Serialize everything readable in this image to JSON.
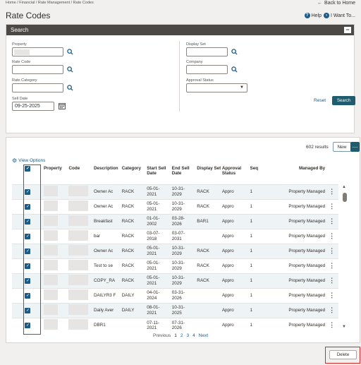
{
  "breadcrumb": "Home / Financial / Rate Management / Rate Codes",
  "back_link": "Back to Home",
  "title": "Rate Codes",
  "help": "Help",
  "want_to": "I Want To...",
  "search_panel": {
    "title": "Search",
    "property_label": "Property",
    "rate_code_label": "Rate Code",
    "rate_category_label": "Rate Category",
    "sell_date_label": "Sell Date",
    "sell_date_value": "09-25-2025",
    "display_set_label": "Display Set",
    "company_label": "Company",
    "approval_status_label": "Approval Status",
    "reset": "Reset",
    "search": "Search"
  },
  "results": {
    "count": "602 results",
    "new": "New",
    "view_options": "View Options",
    "headers": [
      "Property",
      "Code",
      "Description",
      "Category",
      "Start Sell Date",
      "End Sell Date",
      "Display Set",
      "Approval Status",
      "Seq",
      "Managed By"
    ],
    "rows": [
      {
        "description": "Owner Ac",
        "category": "RACK",
        "start": "05-01-2021",
        "end": "10-31-2029",
        "display_set": "RACK",
        "approval": "Appro",
        "seq": "1",
        "managed": "Property Managed"
      },
      {
        "description": "Owner Ac",
        "category": "RACK",
        "start": "05-01-2021",
        "end": "10-31-2029",
        "display_set": "RACK",
        "approval": "Appro",
        "seq": "1",
        "managed": "Property Managed"
      },
      {
        "description": "Breakfast",
        "category": "RACK",
        "start": "01-01-2002",
        "end": "03-28-2026",
        "display_set": "BAR1",
        "approval": "Appro",
        "seq": "1",
        "managed": "Property Managed"
      },
      {
        "description": "bar",
        "category": "RACK",
        "start": "03-07-2018",
        "end": "03-07-2031",
        "display_set": "",
        "approval": "Appro",
        "seq": "1",
        "managed": "Property Managed"
      },
      {
        "description": "Owner Ac",
        "category": "RACK",
        "start": "05-01-2021",
        "end": "10-31-2029",
        "display_set": "RACK",
        "approval": "Appro",
        "seq": "1",
        "managed": "Property Managed"
      },
      {
        "description": "Test to se",
        "category": "RACK",
        "start": "05-01-2021",
        "end": "10-31-2029",
        "display_set": "RACK",
        "approval": "Appro",
        "seq": "1",
        "managed": "Property Managed"
      },
      {
        "description": "COPY_RA",
        "category": "RACK",
        "start": "05-01-2021",
        "end": "10-31-2029",
        "display_set": "RACK",
        "approval": "Appro",
        "seq": "1",
        "managed": "Property Managed"
      },
      {
        "description": "DAILYR3 F",
        "category": "DAILY",
        "start": "04-01-2024",
        "end": "03-31-2026",
        "display_set": "",
        "approval": "Appro",
        "seq": "1",
        "managed": "Property Managed"
      },
      {
        "description": "Daily Aver",
        "category": "DAILY",
        "start": "08-01-2021",
        "end": "10-31-2025",
        "display_set": "",
        "approval": "Appro",
        "seq": "1",
        "managed": "Property Managed"
      },
      {
        "description": "DBR1",
        "category": "",
        "start": "07-11-2021",
        "end": "07-31-2026",
        "display_set": "",
        "approval": "Appro",
        "seq": "1",
        "managed": "Property Managed"
      }
    ]
  },
  "pager": {
    "previous": "Previous",
    "pages": [
      "1",
      "2",
      "3",
      "4"
    ],
    "next": "Next"
  },
  "delete": "Delete"
}
